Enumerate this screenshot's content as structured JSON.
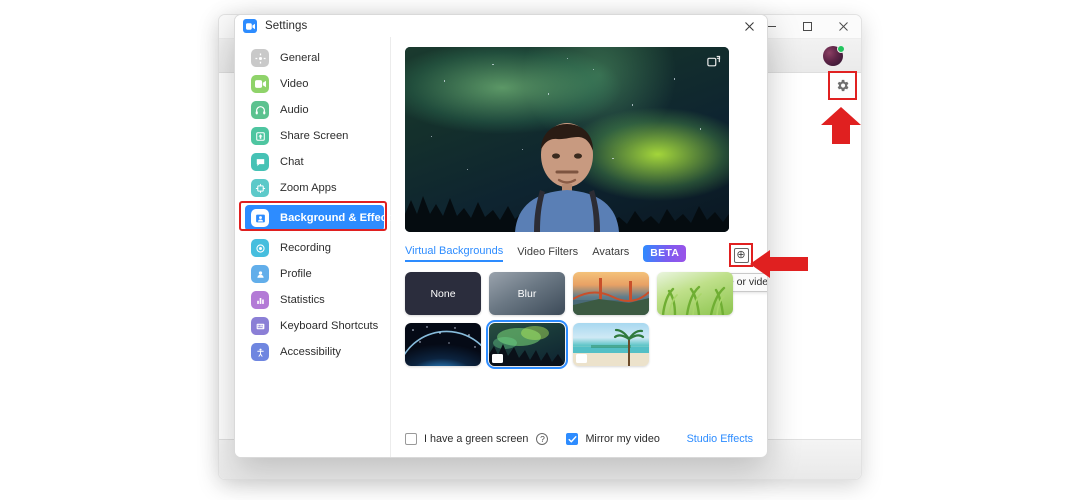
{
  "background_window": {
    "name": "zoom-main-window",
    "window_controls": {
      "minimize": "minimize-icon",
      "maximize": "maximize-icon",
      "close": "close-icon"
    },
    "avatar": {
      "name": "user-avatar",
      "status": "available"
    },
    "gear": {
      "name": "settings-gear-icon",
      "highlight_color": "#e02020"
    }
  },
  "annotations": {
    "arrow_color": "#e02020",
    "highlight_border_color": "#e02020",
    "arrow_up_name": "red-arrow-up",
    "arrow_left_name": "red-arrow-left"
  },
  "settings": {
    "title": "Settings",
    "close_label": "✕",
    "sidebar": {
      "items": [
        {
          "label": "General",
          "icon": "gear-icon",
          "color": "#c9c9c9",
          "active": false
        },
        {
          "label": "Video",
          "icon": "video-camera-icon",
          "color": "#8fd36a",
          "active": false
        },
        {
          "label": "Audio",
          "icon": "headphones-icon",
          "color": "#5cc28f",
          "active": false
        },
        {
          "label": "Share Screen",
          "icon": "share-screen-icon",
          "color": "#4ec5a0",
          "active": false
        },
        {
          "label": "Chat",
          "icon": "chat-bubble-icon",
          "color": "#46c2b5",
          "active": false
        },
        {
          "label": "Zoom Apps",
          "icon": "zoom-apps-icon",
          "color": "#5cc9c9",
          "active": false
        },
        {
          "label": "Background & Effects",
          "icon": "background-effects-icon",
          "color": "#2d8cff",
          "active": true
        },
        {
          "label": "Recording",
          "icon": "recording-icon",
          "color": "#46bede",
          "active": false
        },
        {
          "label": "Profile",
          "icon": "profile-icon",
          "color": "#62aeea",
          "active": false
        },
        {
          "label": "Statistics",
          "icon": "statistics-icon",
          "color": "#b37ad6",
          "active": false
        },
        {
          "label": "Keyboard Shortcuts",
          "icon": "keyboard-icon",
          "color": "#8b7fd6",
          "active": false
        },
        {
          "label": "Accessibility",
          "icon": "accessibility-icon",
          "color": "#6f86e0",
          "active": false
        }
      ]
    },
    "preview": {
      "name": "video-preview",
      "camera_switch_icon": "camera-switch-icon",
      "background_applied": "Aurora"
    },
    "tabs": [
      {
        "label": "Virtual Backgrounds",
        "active": true
      },
      {
        "label": "Video Filters",
        "active": false
      },
      {
        "label": "Avatars",
        "active": false
      }
    ],
    "beta_badge": "BETA",
    "add_button": {
      "name": "add-image-or-video-button",
      "glyph": "⊕",
      "tooltip": "Add image or video"
    },
    "backgrounds": [
      {
        "label": "None",
        "kind": "none",
        "selected": false,
        "downloaded": false
      },
      {
        "label": "Blur",
        "kind": "blur",
        "selected": false,
        "downloaded": false
      },
      {
        "label": "",
        "kind": "bridge",
        "selected": false,
        "downloaded": false
      },
      {
        "label": "",
        "kind": "grass",
        "selected": false,
        "downloaded": false
      },
      {
        "label": "",
        "kind": "earth",
        "selected": false,
        "downloaded": false
      },
      {
        "label": "",
        "kind": "aurora",
        "selected": true,
        "downloaded": true
      },
      {
        "label": "",
        "kind": "beach",
        "selected": false,
        "downloaded": true
      }
    ],
    "footer": {
      "green_screen_label": "I have a green screen",
      "green_screen_checked": false,
      "help_glyph": "?",
      "mirror_label": "Mirror my video",
      "mirror_checked": true,
      "studio_effects_label": "Studio Effects"
    }
  },
  "colors": {
    "accent": "#2d8cff",
    "highlight": "#e02020",
    "beta_gradient_from": "#2d8cff",
    "beta_gradient_to": "#9b53e8"
  }
}
